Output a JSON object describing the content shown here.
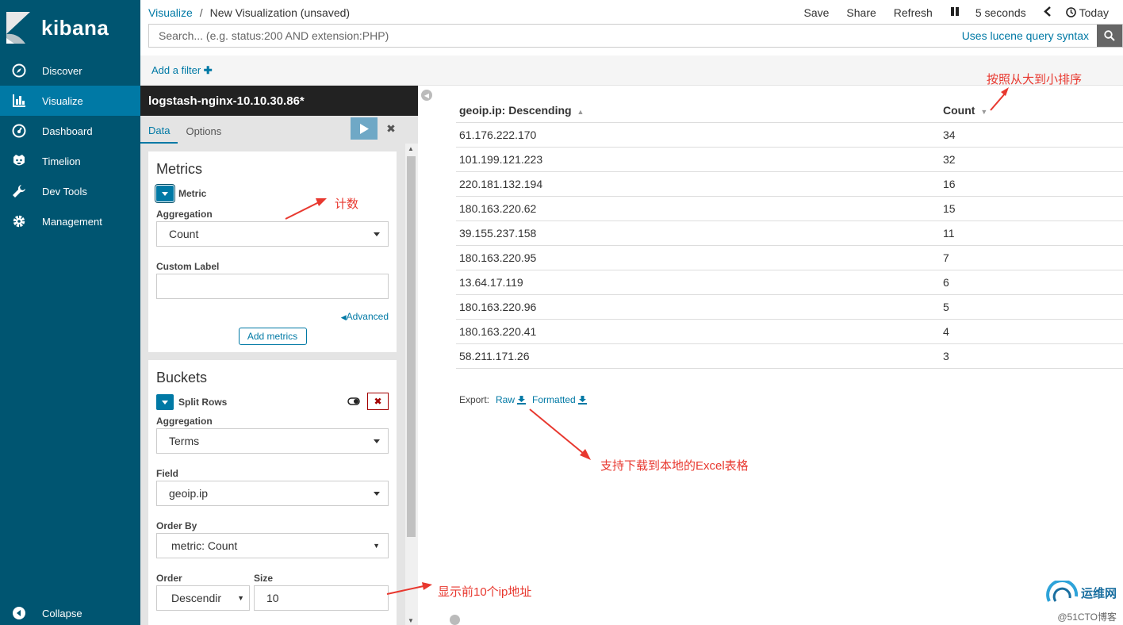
{
  "brand": {
    "name": "kibana"
  },
  "sidebar": {
    "items": [
      {
        "label": "Discover",
        "icon": "compass-icon",
        "active": false
      },
      {
        "label": "Visualize",
        "icon": "bar-chart-icon",
        "active": true
      },
      {
        "label": "Dashboard",
        "icon": "dashboard-icon",
        "active": false
      },
      {
        "label": "Timelion",
        "icon": "timelion-icon",
        "active": false
      },
      {
        "label": "Dev Tools",
        "icon": "wrench-icon",
        "active": false
      },
      {
        "label": "Management",
        "icon": "gear-icon",
        "active": false
      }
    ],
    "collapse_label": "Collapse"
  },
  "breadcrumb": {
    "parent": "Visualize",
    "separator": "/",
    "current": "New Visualization (unsaved)"
  },
  "top_actions": {
    "save": "Save",
    "share": "Share",
    "refresh": "Refresh",
    "interval": "5 seconds",
    "time": "Today"
  },
  "search": {
    "placeholder": "Search... (e.g. status:200 AND extension:PHP)",
    "syntax_link": "Uses lucene query syntax"
  },
  "filter": {
    "add_label": "Add a filter"
  },
  "editor": {
    "index_pattern": "logstash-nginx-10.10.30.86*",
    "tabs": [
      "Data",
      "Options"
    ],
    "metrics": {
      "title": "Metrics",
      "agg_title": "Metric",
      "aggregation_label": "Aggregation",
      "aggregation_value": "Count",
      "custom_label": "Custom Label",
      "custom_value": "",
      "advanced": "Advanced",
      "add_button": "Add metrics"
    },
    "buckets": {
      "title": "Buckets",
      "agg_title": "Split Rows",
      "aggregation_label": "Aggregation",
      "aggregation_value": "Terms",
      "field_label": "Field",
      "field_value": "geoip.ip",
      "order_by_label": "Order By",
      "order_by_value": "metric: Count",
      "order_label": "Order",
      "order_value": "Descendir",
      "size_label": "Size",
      "size_value": "10"
    }
  },
  "table": {
    "headers": [
      "geoip.ip: Descending",
      "Count"
    ],
    "rows": [
      [
        "61.176.222.170",
        "34"
      ],
      [
        "101.199.121.223",
        "32"
      ],
      [
        "220.181.132.194",
        "16"
      ],
      [
        "180.163.220.62",
        "15"
      ],
      [
        "39.155.237.158",
        "11"
      ],
      [
        "180.163.220.95",
        "7"
      ],
      [
        "13.64.17.119",
        "6"
      ],
      [
        "180.163.220.96",
        "5"
      ],
      [
        "180.163.220.41",
        "4"
      ],
      [
        "58.211.171.26",
        "3"
      ]
    ]
  },
  "export": {
    "label": "Export:",
    "raw": "Raw",
    "formatted": "Formatted"
  },
  "annotations": {
    "sort": "按照从大到小排序",
    "count": "计数",
    "download": "支持下载到本地的Excel表格",
    "top10": "显示前10个ip地址"
  },
  "watermark": {
    "text": "运维网",
    "sub": "@51CTO博客"
  },
  "colors": {
    "sidebar": "#005571",
    "active": "#0079a5",
    "annotation": "#e8382f"
  }
}
